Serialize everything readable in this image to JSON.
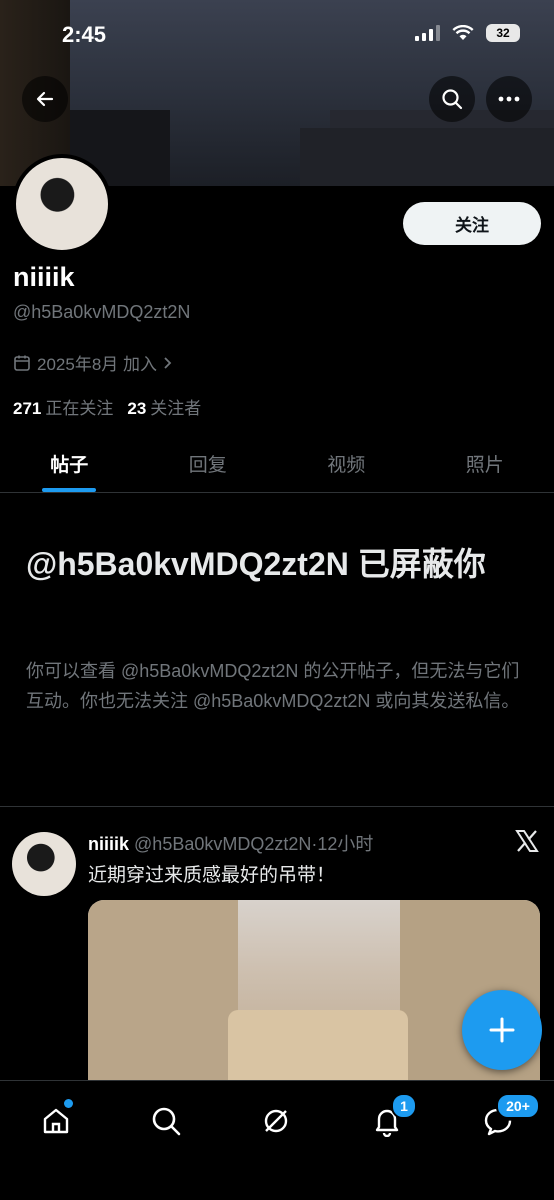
{
  "status_bar": {
    "time": "2:45",
    "battery": "32"
  },
  "profile": {
    "name": "niiiik",
    "handle": "@h5Ba0kvMDQ2zt2N",
    "joined": "2025年8月 加入",
    "following_count": "271",
    "following_label": "正在关注",
    "followers_count": "23",
    "followers_label": "关注者",
    "follow_button": "关注"
  },
  "tabs": [
    {
      "label": "帖子",
      "active": true
    },
    {
      "label": "回复",
      "active": false
    },
    {
      "label": "视频",
      "active": false
    },
    {
      "label": "照片",
      "active": false
    }
  ],
  "blocked": {
    "title": "@h5Ba0kvMDQ2zt2N 已屏蔽你",
    "description": "你可以查看 @h5Ba0kvMDQ2zt2N 的公开帖子，但无法与它们互动。你也无法关注 @h5Ba0kvMDQ2zt2N 或向其发送私信。"
  },
  "post": {
    "author": "niiiik",
    "handle": "@h5Ba0kvMDQ2zt2N",
    "separator": "·",
    "time": "12小时",
    "text": "近期穿过来质感最好的吊带！"
  },
  "bottom_nav": {
    "notifications_badge": "1",
    "messages_badge": "20+"
  },
  "colors": {
    "accent": "#1d9bf0",
    "background": "#000000",
    "muted": "#71767b"
  }
}
